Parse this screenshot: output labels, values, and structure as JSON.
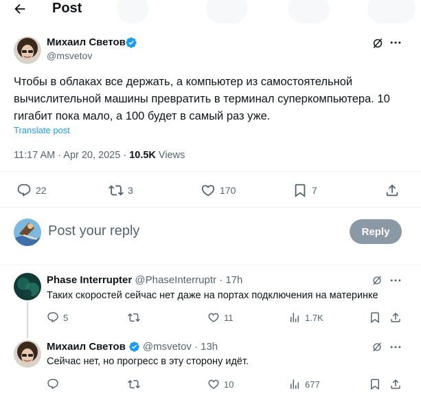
{
  "header": {
    "title": "Post"
  },
  "post": {
    "author_name": "Михаил Светов",
    "author_handle": "@msvetov",
    "text": "Чтобы в облаках все держать, а компьютер из самостоятельной вычислительной машины превратить в терминал суперкомпьютера. 10 гигабит пока мало, а 100 будет в самый раз уже.",
    "translate_label": "Translate post",
    "time": "11:17 AM · Apr 20, 2025 · ",
    "views_count": "10.5K",
    "views_label": " Views",
    "replies": "22",
    "reposts": "3",
    "likes": "170",
    "bookmarks": "7"
  },
  "composer": {
    "placeholder": "Post your reply",
    "reply_button": "Reply"
  },
  "replies": [
    {
      "author_name": "Phase Interrupter",
      "author_handle": "@PhaseInterruptr",
      "time": "· 17h",
      "text": "Таких скоростей сейчас нет даже на портах подключения на материнке",
      "replies": "5",
      "reposts": "",
      "likes": "11",
      "views": "1.7K"
    },
    {
      "author_name": "Михаил Светов",
      "author_handle": "@msvetov",
      "time": "· 13h",
      "text": "Сейчас нет, но прогресс в эту сторону идёт.",
      "replies": "",
      "reposts": "",
      "likes": "10",
      "views": "677"
    }
  ],
  "colors": {
    "accent": "#1d9bf0",
    "muted": "#536471",
    "reply_button_disabled": "#8b98a5"
  }
}
